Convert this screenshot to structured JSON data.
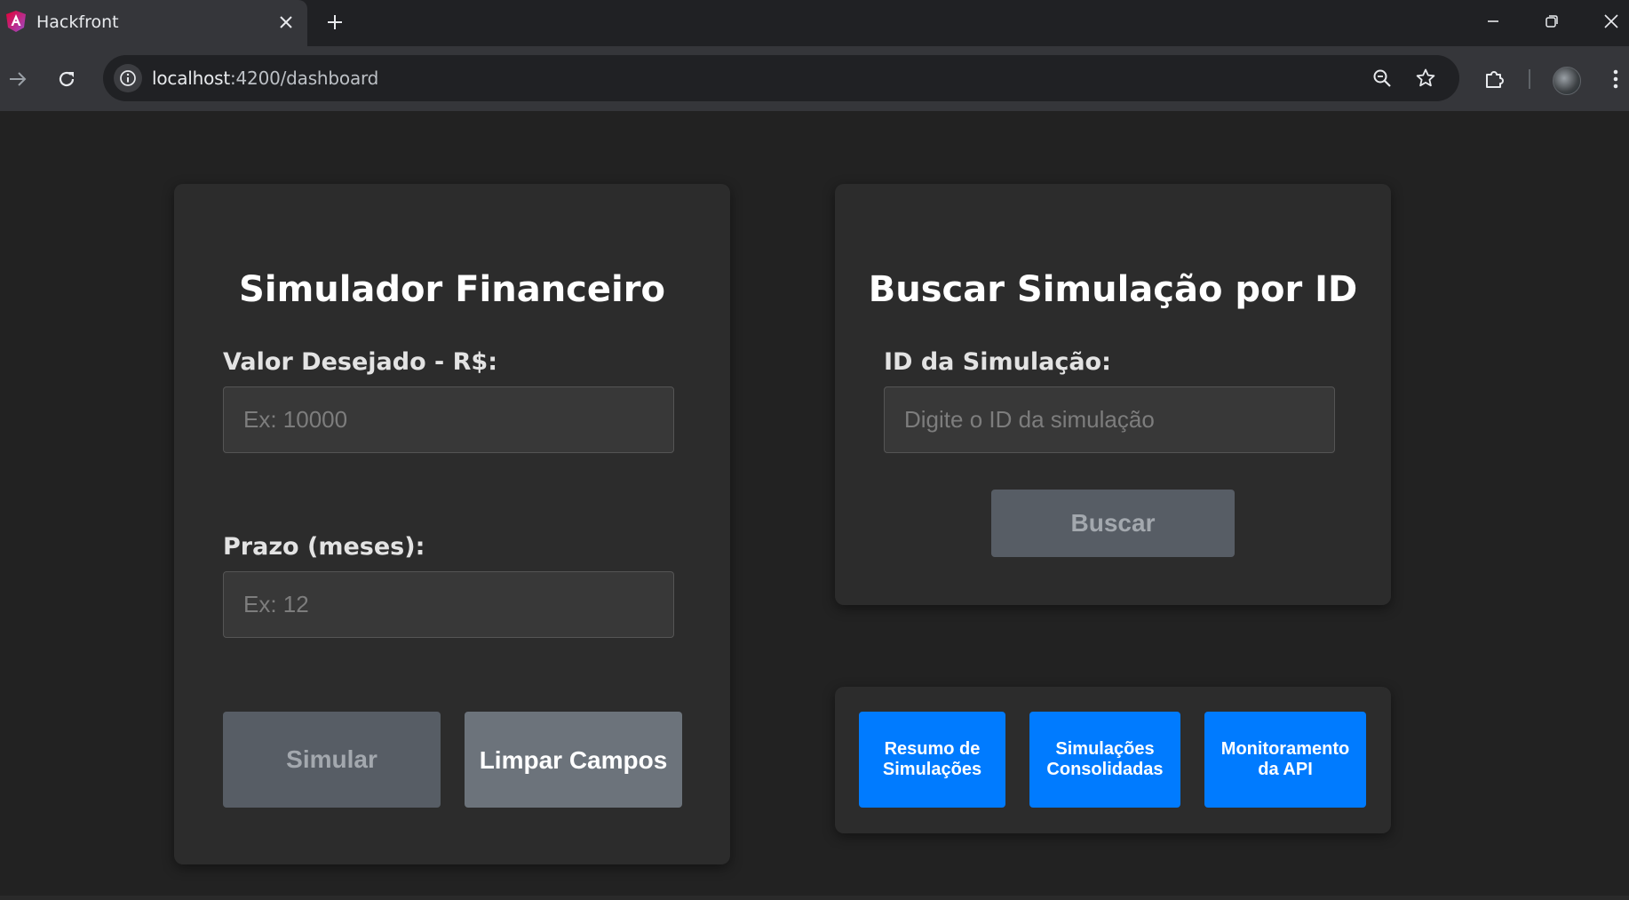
{
  "browser": {
    "tab_title": "Hackfront",
    "url_host": "localhost",
    "url_path": ":4200/dashboard"
  },
  "simulator": {
    "title": "Simulador Financeiro",
    "amount_label": "Valor Desejado - R$:",
    "amount_value": "",
    "amount_placeholder": "Ex: 10000",
    "term_label": "Prazo (meses):",
    "term_value": "",
    "term_placeholder": "Ex: 12",
    "simulate_label": "Simular",
    "clear_label": "Limpar Campos"
  },
  "search": {
    "title": "Buscar Simulação por ID",
    "id_label": "ID da Simulação:",
    "id_value": "",
    "id_placeholder": "Digite o ID da simulação",
    "search_label": "Buscar"
  },
  "nav": {
    "summary_label": "Resumo de Simulações",
    "consolidated_label": "Simulações Consolidadas",
    "monitoring_label": "Monitoramento da API"
  },
  "colors": {
    "primary_blue": "#007bff",
    "disabled_button": "#575d65",
    "secondary_button": "#6c737b",
    "card_background": "#2c2c2c"
  },
  "icons": {
    "favicon": "angular-icon",
    "tab_close": "close-icon",
    "new_tab": "plus-icon",
    "back": "arrow-left-icon",
    "forward": "arrow-right-icon",
    "reload": "reload-icon",
    "site_info": "info-icon",
    "zoom": "zoom-icon",
    "bookmark": "star-icon",
    "extensions": "puzzle-icon",
    "menu": "kebab-menu-icon"
  }
}
